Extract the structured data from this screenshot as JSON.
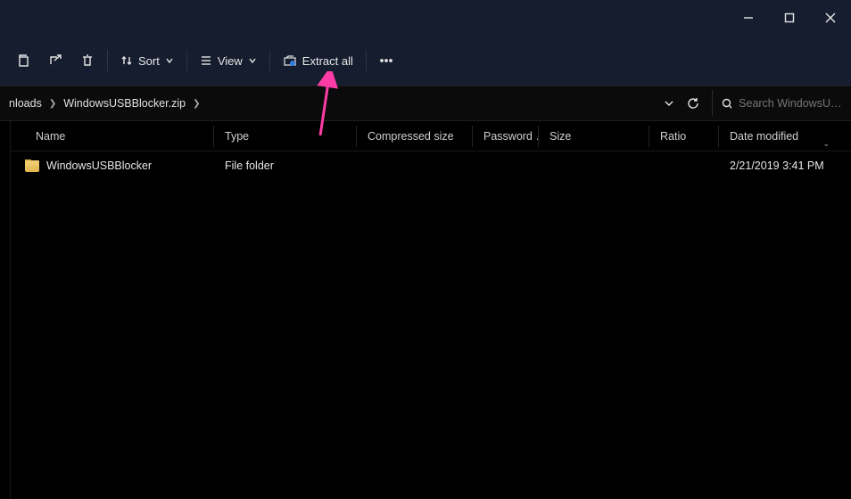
{
  "toolbar": {
    "sort_label": "Sort",
    "view_label": "View",
    "extract_label": "Extract all"
  },
  "breadcrumb": {
    "segments": [
      "nloads",
      "WindowsUSBBlocker.zip"
    ]
  },
  "search": {
    "placeholder": "Search WindowsU…"
  },
  "columns": {
    "name": "Name",
    "type": "Type",
    "compressed_size": "Compressed size",
    "password": "Password …",
    "size": "Size",
    "ratio": "Ratio",
    "date_modified": "Date modified"
  },
  "rows": [
    {
      "name": "WindowsUSBBlocker",
      "type": "File folder",
      "compressed_size": "",
      "password": "",
      "size": "",
      "ratio": "",
      "date_modified": "2/21/2019 3:41 PM"
    }
  ],
  "annotation": {
    "color": "#ff3ca6"
  }
}
